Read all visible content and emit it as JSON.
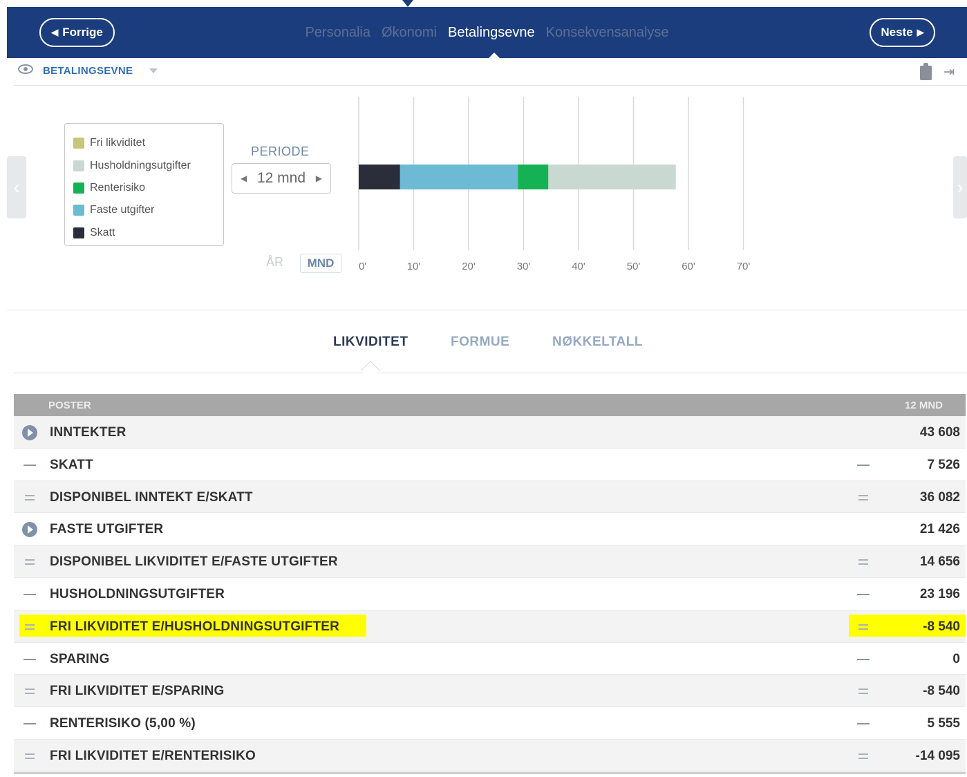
{
  "nav": {
    "prev_label": "Forrige",
    "next_label": "Neste",
    "steps": [
      "Personalia",
      "Økonomi",
      "Betalingsevne",
      "Konsekvensanalyse"
    ],
    "active_step": "Betalingsevne"
  },
  "subheader": {
    "title": "BETALINGSEVNE"
  },
  "legend": [
    {
      "label": "Fri likviditet",
      "color": "#c9c57a"
    },
    {
      "label": "Husholdningsutgifter",
      "color": "#c9d9d2"
    },
    {
      "label": "Renterisiko",
      "color": "#14b254"
    },
    {
      "label": "Faste utgifter",
      "color": "#6cbad3"
    },
    {
      "label": "Skatt",
      "color": "#2b2e3a"
    }
  ],
  "period": {
    "label": "PERIODE",
    "value": "12 mnd",
    "year_button": "ÅR",
    "month_button": "MND"
  },
  "chart_data": {
    "type": "bar",
    "orientation": "horizontal-stacked",
    "x_ticks": [
      "0'",
      "10'",
      "20'",
      "30'",
      "40'",
      "50'",
      "60'",
      "70'"
    ],
    "xlim": [
      0,
      70
    ],
    "grid": true,
    "series": [
      {
        "name": "Skatt",
        "value": 7.526,
        "color": "#2b2e3a"
      },
      {
        "name": "Faste utgifter",
        "value": 21.426,
        "color": "#6cbad3"
      },
      {
        "name": "Renterisiko",
        "value": 5.555,
        "color": "#14b254"
      },
      {
        "name": "Husholdningsutgifter",
        "value": 23.196,
        "color": "#c9d9d2"
      }
    ]
  },
  "tabs": [
    "LIKVIDITET",
    "FORMUE",
    "NØKKELTALL"
  ],
  "active_tab": "LIKVIDITET",
  "table": {
    "header_left": "POSTER",
    "header_right": "12 MND",
    "rows": [
      {
        "symbol": "play",
        "label": "INNTEKTER",
        "symbol2": "",
        "value": "43 608",
        "highlight": false
      },
      {
        "symbol": "dash",
        "label": "SKATT",
        "symbol2": "dash",
        "value": "7 526",
        "highlight": false
      },
      {
        "symbol": "eq",
        "label": "DISPONIBEL INNTEKT E/SKATT",
        "symbol2": "eq",
        "value": "36 082",
        "highlight": false
      },
      {
        "symbol": "play",
        "label": "FASTE UTGIFTER",
        "symbol2": "",
        "value": "21 426",
        "highlight": false
      },
      {
        "symbol": "eq",
        "label": "DISPONIBEL LIKVIDITET E/FASTE UTGIFTER",
        "symbol2": "eq",
        "value": "14 656",
        "highlight": false
      },
      {
        "symbol": "dash",
        "label": "HUSHOLDNINGSUTGIFTER",
        "symbol2": "dash",
        "value": "23 196",
        "highlight": false
      },
      {
        "symbol": "eq",
        "label": "FRI LIKVIDITET E/HUSHOLDNINGSUTGIFTER",
        "symbol2": "eq",
        "value": "-8 540",
        "highlight": true
      },
      {
        "symbol": "dash",
        "label": "SPARING",
        "symbol2": "dash",
        "value": "0",
        "highlight": false
      },
      {
        "symbol": "eq",
        "label": "FRI LIKVIDITET E/SPARING",
        "symbol2": "eq",
        "value": "-8 540",
        "highlight": false
      },
      {
        "symbol": "dash",
        "label": "RENTERISIKO (5,00 %)",
        "symbol2": "dash",
        "value": "5 555",
        "highlight": false
      },
      {
        "symbol": "eq",
        "label": "FRI LIKVIDITET E/RENTERISIKO",
        "symbol2": "eq",
        "value": "-14 095",
        "highlight": false
      }
    ]
  }
}
